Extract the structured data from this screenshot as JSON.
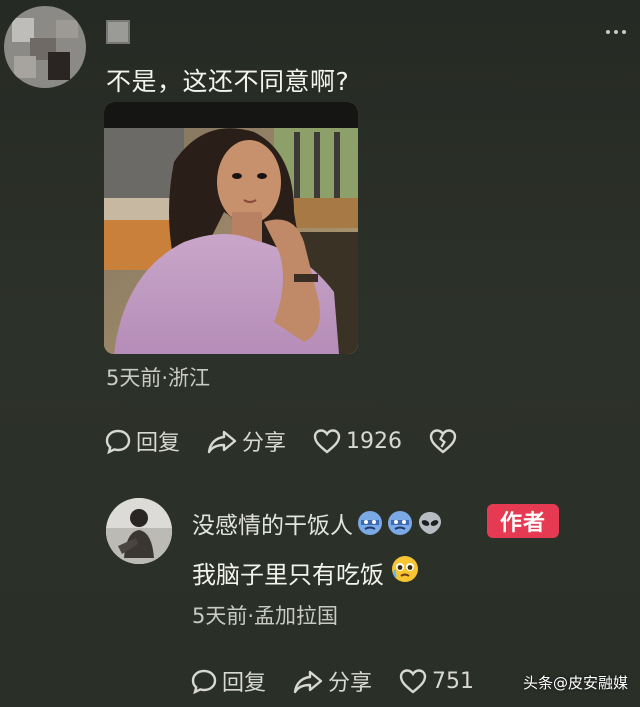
{
  "comment": {
    "text": "不是，这还不同意啊?",
    "time_location": "5天前·浙江",
    "actions": {
      "reply_label": "回复",
      "share_label": "分享",
      "like_count": "1926"
    }
  },
  "reply": {
    "username": "没感情的干饭人",
    "author_badge": "作者",
    "text": "我脑子里只有吃饭",
    "time_location": "5天前·孟加拉国",
    "actions": {
      "reply_label": "回复",
      "share_label": "分享",
      "like_count": "751"
    }
  },
  "watermark": {
    "text": "头条@皮安融媒"
  },
  "icons": {
    "reply": "chat-bubble-icon",
    "share": "share-arrow-icon",
    "like": "heart-outline-icon",
    "dislike": "broken-heart-icon",
    "more": "ellipsis-icon"
  },
  "colors": {
    "badge": "#e63a53",
    "background": "#2a2f28"
  }
}
